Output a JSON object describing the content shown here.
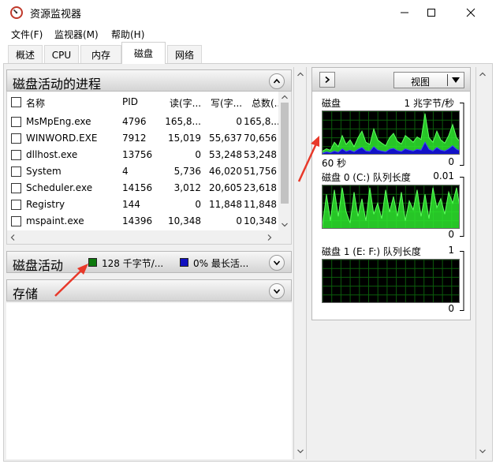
{
  "window": {
    "title": "资源监视器"
  },
  "menu": [
    {
      "label": "文件(F)"
    },
    {
      "label": "监视器(M)"
    },
    {
      "label": "帮助(H)"
    }
  ],
  "tabs": [
    {
      "label": "概述"
    },
    {
      "label": "CPU"
    },
    {
      "label": "内存"
    },
    {
      "label": "磁盘",
      "active": true
    },
    {
      "label": "网络"
    }
  ],
  "processes_section": {
    "title": "磁盘活动的进程",
    "columns": [
      "名称",
      "PID",
      "读(字...",
      "写(字...",
      "总数(..."
    ],
    "rows": [
      {
        "name": "MsMpEng.exe",
        "pid": "4796",
        "read": "165,8...",
        "write": "0",
        "total": "165,8..."
      },
      {
        "name": "WINWORD.EXE",
        "pid": "7912",
        "read": "15,019",
        "write": "55,637",
        "total": "70,656"
      },
      {
        "name": "dllhost.exe",
        "pid": "13756",
        "read": "0",
        "write": "53,248",
        "total": "53,248"
      },
      {
        "name": "System",
        "pid": "4",
        "read": "5,736",
        "write": "46,020",
        "total": "51,756"
      },
      {
        "name": "Scheduler.exe",
        "pid": "14156",
        "read": "3,012",
        "write": "20,605",
        "total": "23,618"
      },
      {
        "name": "Registry",
        "pid": "144",
        "read": "0",
        "write": "11,848",
        "total": "11,848"
      },
      {
        "name": "mspaint.exe",
        "pid": "14396",
        "read": "10,348",
        "write": "0",
        "total": "10,348"
      }
    ]
  },
  "disk_activity_section": {
    "title": "磁盘活动",
    "legend": [
      {
        "text": "128 千字节/...",
        "color": "#0d7a0d"
      },
      {
        "text": "0% 最长活...",
        "color": "#1010c0"
      }
    ]
  },
  "storage_section": {
    "title": "存储"
  },
  "right_panel": {
    "view_label": "视图",
    "graphs": [
      {
        "label": "磁盘",
        "max": "1 兆字节/秒",
        "min": "0",
        "time": "60 秒",
        "series_a": [
          0.1,
          0.15,
          0.12,
          0.3,
          0.2,
          0.45,
          0.25,
          0.35,
          0.2,
          0.4,
          0.55,
          0.3,
          0.25,
          0.6,
          0.35,
          0.28,
          0.22,
          0.4,
          0.5,
          0.32,
          0.26,
          0.45,
          0.38,
          0.3,
          0.42,
          0.36,
          0.95,
          0.4,
          0.3,
          0.55,
          0.35,
          0.28,
          0.45,
          0.7,
          0.4,
          0.3
        ],
        "series_b": [
          0.05,
          0.08,
          0.06,
          0.1,
          0.07,
          0.15,
          0.09,
          0.12,
          0.08,
          0.14,
          0.18,
          0.1,
          0.09,
          0.2,
          0.12,
          0.1,
          0.08,
          0.14,
          0.16,
          0.11,
          0.09,
          0.15,
          0.12,
          0.1,
          0.14,
          0.12,
          0.3,
          0.14,
          0.1,
          0.18,
          0.12,
          0.1,
          0.15,
          0.22,
          0.14,
          0.1
        ]
      },
      {
        "label": "磁盘 0 (C:) 队列长度",
        "max": "0.01",
        "min": "0",
        "series_a": [
          0.1,
          0.8,
          0.2,
          0.9,
          0.3,
          0.95,
          0.4,
          0.15,
          0.85,
          0.3,
          0.7,
          0.2,
          0.95,
          0.35,
          0.6,
          0.25,
          0.9,
          0.4,
          0.75,
          0.3,
          0.85,
          0.2,
          0.65,
          0.45,
          0.9,
          0.3,
          0.8,
          0.25,
          0.95,
          0.5,
          0.7,
          0.35,
          0.85,
          0.6,
          0.95,
          0.4
        ]
      },
      {
        "label": "磁盘 1 (E: F:) 队列长度",
        "max": "1",
        "min": "0",
        "series_a": []
      }
    ]
  },
  "colors": {
    "graph_green": "#2ee82e",
    "graph_grid": "#0b5c0b",
    "annotation_red": "#e8392a"
  }
}
